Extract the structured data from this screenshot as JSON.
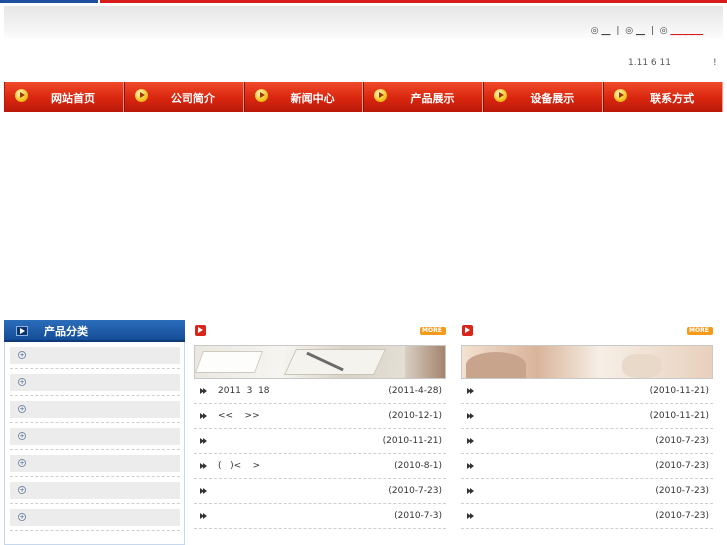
{
  "header": {
    "toplinks": [
      {
        "icon": "◎",
        "label": "__"
      },
      {
        "icon": "◎",
        "label": "__"
      },
      {
        "icon": "◎",
        "label": "_____"
      }
    ],
    "separator": "|",
    "notice_text": "1.11 6 11",
    "notice_mark": "!"
  },
  "nav": {
    "items": [
      {
        "label": "网站首页"
      },
      {
        "label": "公司简介"
      },
      {
        "label": "新闻中心"
      },
      {
        "label": "产品展示"
      },
      {
        "label": "设备展示"
      },
      {
        "label": "联系方式"
      }
    ]
  },
  "sidebar": {
    "title": "产品分类",
    "categories": [
      {
        "label": ""
      },
      {
        "label": ""
      },
      {
        "label": ""
      },
      {
        "label": ""
      },
      {
        "label": ""
      },
      {
        "label": ""
      },
      {
        "label": ""
      }
    ]
  },
  "columns": [
    {
      "more_label": "MORE",
      "rows": [
        {
          "title": "2011  3  18",
          "date": "(2011-4-28)"
        },
        {
          "title": "<<    >>",
          "date": "(2010-12-1)"
        },
        {
          "title": "",
          "date": "(2010-11-21)"
        },
        {
          "title": "(   )<    >",
          "date": "(2010-8-1)"
        },
        {
          "title": "",
          "date": "(2010-7-23)"
        },
        {
          "title": "",
          "date": "(2010-7-3)"
        }
      ]
    },
    {
      "more_label": "MORE",
      "rows": [
        {
          "title": "",
          "date": "(2010-11-21)"
        },
        {
          "title": "",
          "date": "(2010-11-21)"
        },
        {
          "title": "",
          "date": "(2010-7-23)"
        },
        {
          "title": "",
          "date": "(2010-7-23)"
        },
        {
          "title": "",
          "date": "(2010-7-23)"
        },
        {
          "title": "",
          "date": "(2010-7-23)"
        }
      ]
    }
  ],
  "colors": {
    "brand_red": "#d81c1c",
    "brand_blue": "#1d4f9c",
    "more_orange": "#f59a1b"
  }
}
